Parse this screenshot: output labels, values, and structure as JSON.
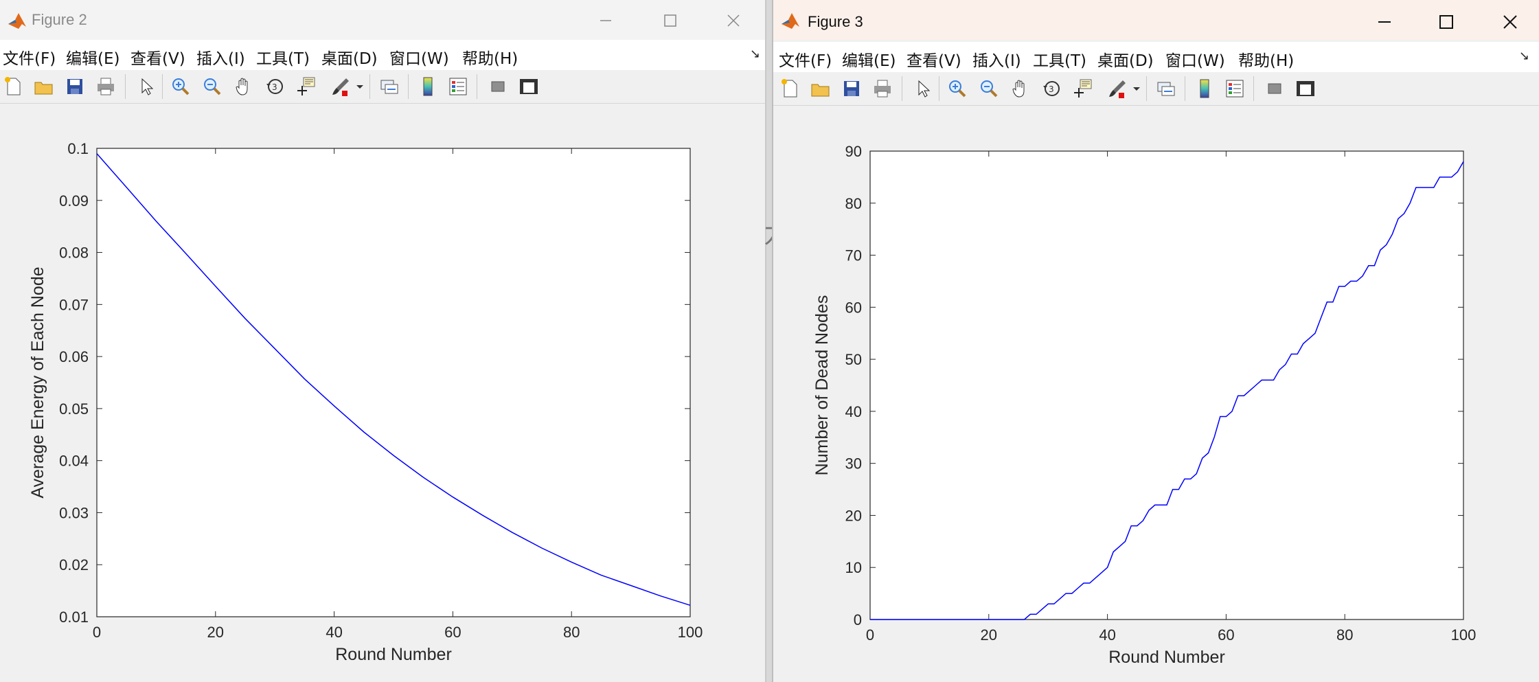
{
  "colors": {
    "line": "#0000ff",
    "axes": "#262626",
    "background": "#f0f0f0",
    "title_bar_active": "#fbf0ea"
  },
  "icons": [
    "matlab-logo-icon",
    "new-figure-icon",
    "open-file-icon",
    "save-icon",
    "print-icon",
    "select-pointer-icon",
    "zoom-in-icon",
    "zoom-out-icon",
    "pan-hand-icon",
    "rotate-3d-icon",
    "data-cursor-icon",
    "brush-icon",
    "brush-dropdown-icon",
    "link-plot-icon",
    "insert-colorbar-icon",
    "insert-legend-icon",
    "hide-plot-tools-icon",
    "show-plot-tools-icon",
    "minimize-icon",
    "maximize-icon",
    "close-icon"
  ],
  "menu": [
    "文件(F)",
    "编辑(E)",
    "查看(V)",
    "插入(I)",
    "工具(T)",
    "桌面(D)",
    "窗口(W)",
    "帮助(H)"
  ],
  "windows": [
    {
      "title": "Figure 2",
      "menu_overflow": "↘"
    },
    {
      "title": "Figure 3",
      "menu_overflow": "↘"
    }
  ],
  "background_text": "力",
  "chart_data": [
    {
      "type": "line",
      "title": "",
      "xlabel": "Round Number",
      "ylabel": "Average Energy of Each Node",
      "xlim": [
        0,
        100
      ],
      "ylim": [
        0.01,
        0.1
      ],
      "xticks": [
        "0",
        "20",
        "40",
        "60",
        "80",
        "100"
      ],
      "yticks": [
        "0.01",
        "0.02",
        "0.03",
        "0.04",
        "0.05",
        "0.06",
        "0.07",
        "0.08",
        "0.09",
        "0.1"
      ],
      "grid": false,
      "x": [
        0,
        5,
        10,
        15,
        20,
        25,
        30,
        35,
        40,
        45,
        50,
        55,
        60,
        65,
        70,
        75,
        80,
        85,
        90,
        95,
        100
      ],
      "y": [
        0.099,
        0.0925,
        0.086,
        0.0798,
        0.0735,
        0.0673,
        0.0615,
        0.0557,
        0.0505,
        0.0455,
        0.041,
        0.0368,
        0.033,
        0.0295,
        0.0262,
        0.0232,
        0.0205,
        0.018,
        0.016,
        0.014,
        0.0122
      ]
    },
    {
      "type": "line",
      "title": "",
      "xlabel": "Round Number",
      "ylabel": "Number of Dead Nodes",
      "xlim": [
        0,
        100
      ],
      "ylim": [
        0,
        90
      ],
      "xticks": [
        "0",
        "20",
        "40",
        "60",
        "80",
        "100"
      ],
      "yticks": [
        "0",
        "10",
        "20",
        "30",
        "40",
        "50",
        "60",
        "70",
        "80",
        "90"
      ],
      "grid": false,
      "x": [
        0,
        26,
        27,
        28,
        29,
        30,
        31,
        32,
        33,
        34,
        35,
        36,
        37,
        38,
        39,
        40,
        41,
        42,
        43,
        44,
        45,
        46,
        47,
        48,
        49,
        50,
        51,
        52,
        53,
        54,
        55,
        56,
        57,
        58,
        59,
        60,
        61,
        62,
        63,
        64,
        65,
        66,
        67,
        68,
        69,
        70,
        71,
        72,
        73,
        74,
        75,
        76,
        77,
        78,
        79,
        80,
        81,
        82,
        83,
        84,
        85,
        86,
        87,
        88,
        89,
        90,
        91,
        92,
        93,
        94,
        95,
        96,
        97,
        98,
        99,
        100
      ],
      "y": [
        0,
        0,
        1,
        1,
        2,
        3,
        3,
        4,
        5,
        5,
        6,
        7,
        7,
        8,
        9,
        10,
        13,
        14,
        15,
        18,
        18,
        19,
        21,
        22,
        22,
        22,
        25,
        25,
        27,
        27,
        28,
        31,
        32,
        35,
        39,
        39,
        40,
        43,
        43,
        44,
        45,
        46,
        46,
        46,
        48,
        49,
        51,
        51,
        53,
        54,
        55,
        58,
        61,
        61,
        64,
        64,
        65,
        65,
        66,
        68,
        68,
        71,
        72,
        74,
        77,
        78,
        80,
        83,
        83,
        83,
        83,
        85,
        85,
        85,
        86,
        88
      ]
    }
  ]
}
